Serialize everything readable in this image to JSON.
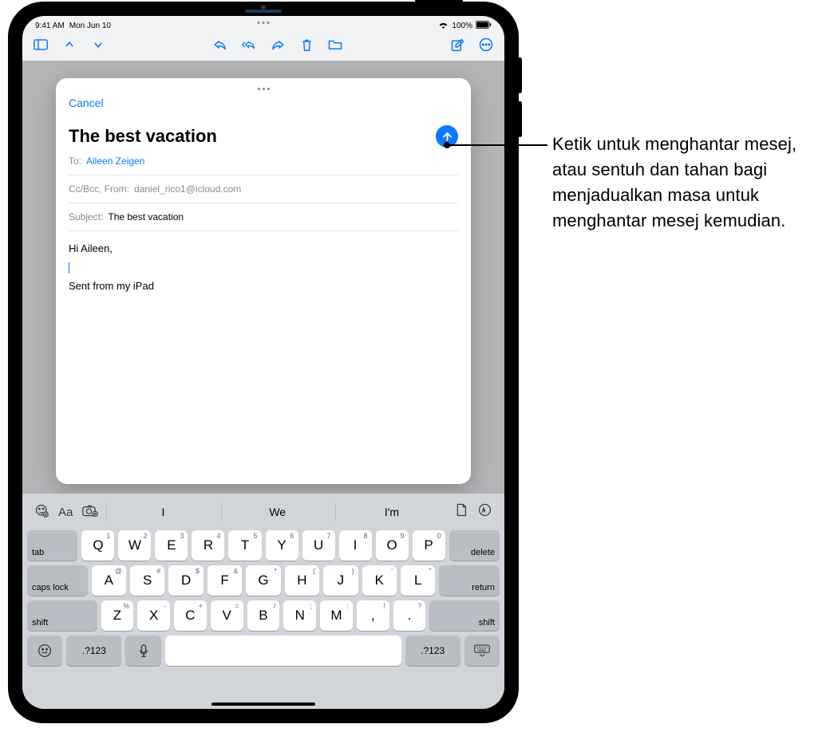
{
  "status": {
    "time": "9:41 AM",
    "date": "Mon Jun 10",
    "battery": "100%",
    "wifi": "wifi-icon"
  },
  "toolbar": {
    "sidebar": "sidebar-icon",
    "up": "chevron-up",
    "down": "chevron-down",
    "reply": "reply",
    "reply_all": "reply-all",
    "forward": "forward",
    "trash": "trash",
    "folder": "folder",
    "compose": "compose",
    "more": "more"
  },
  "compose": {
    "cancel": "Cancel",
    "title": "The best vacation",
    "to_label": "To:",
    "to_value": "Aileen Zeigen",
    "ccbcc_label": "Cc/Bcc, From:",
    "from_value": "daniel_rico1@icloud.com",
    "subject_label": "Subject:",
    "subject_value": "The best vacation",
    "body_greeting": "Hi Aileen,",
    "signature": "Sent from my iPad"
  },
  "predictions": [
    "I",
    "We",
    "I'm"
  ],
  "keyboard": {
    "row1_hints": [
      "1",
      "2",
      "3",
      "4",
      "5",
      "6",
      "7",
      "8",
      "9",
      "0"
    ],
    "row1": [
      "Q",
      "W",
      "E",
      "R",
      "T",
      "Y",
      "U",
      "I",
      "O",
      "P"
    ],
    "row2_hints": [
      "@",
      "#",
      "$",
      "&",
      "*",
      "(",
      ")",
      "'",
      "\""
    ],
    "row2": [
      "A",
      "S",
      "D",
      "F",
      "G",
      "H",
      "J",
      "K",
      "L"
    ],
    "row3_hints": [
      "%",
      "-",
      "+",
      "=",
      "/",
      ";",
      ":",
      "!",
      "?"
    ],
    "row3": [
      "Z",
      "X",
      "C",
      "V",
      "B",
      "N",
      "M",
      ",",
      "."
    ],
    "tab": "tab",
    "delete": "delete",
    "caps": "caps lock",
    "return": "return",
    "shift": "shift",
    "numkey": ".?123"
  },
  "callout": "Ketik untuk menghantar mesej, atau sentuh dan tahan bagi menjadualkan masa untuk menghantar mesej kemudian."
}
